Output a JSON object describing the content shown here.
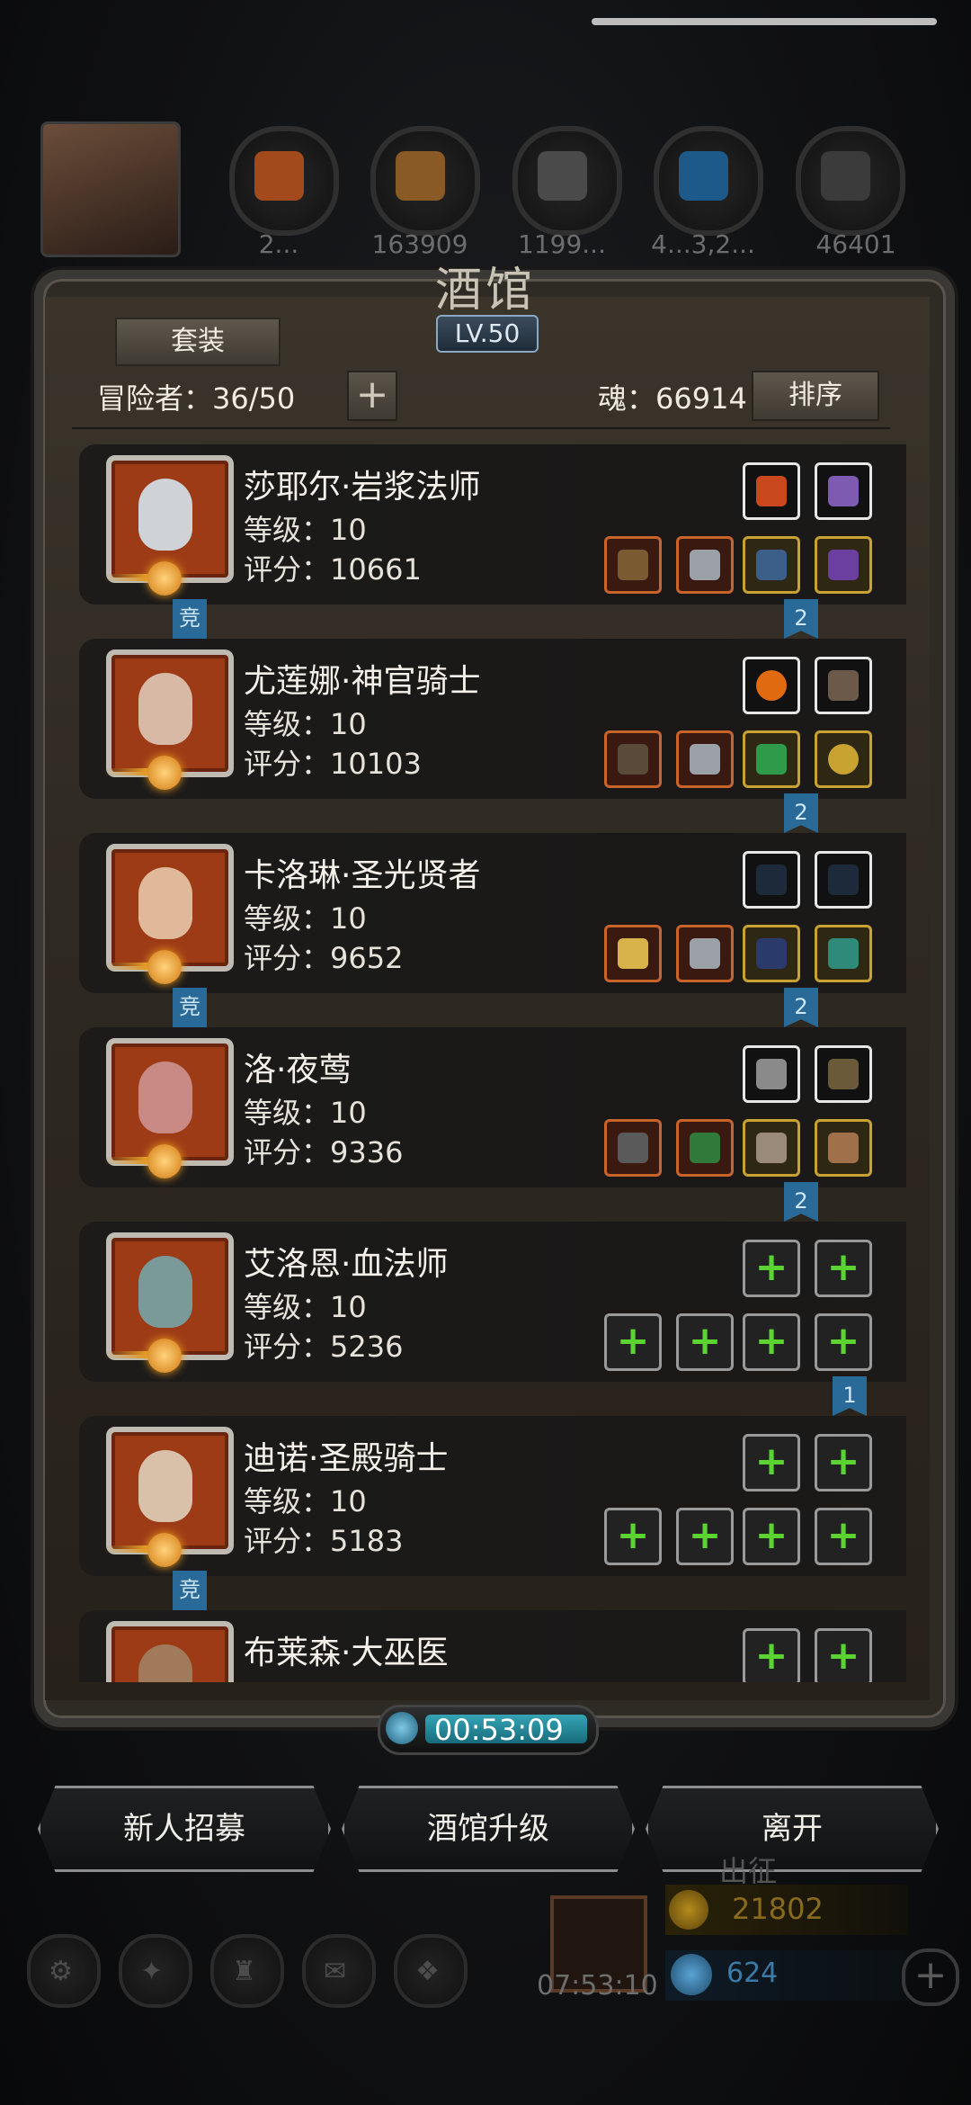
{
  "header": {
    "resources": [
      "2...",
      "163909",
      "1199...",
      "4...3,2...",
      "46401"
    ],
    "title": "酒馆",
    "level": "LV.50"
  },
  "toolbar": {
    "suit_label": "套装",
    "adventurers": "冒险者：36/50",
    "soul": "魂：66914",
    "sort_label": "排序"
  },
  "heroes": [
    {
      "name": "莎耶尔·岩浆法师",
      "level": "等级：10",
      "score": "评分：10661",
      "left_tag": "竞",
      "right_tag": "2"
    },
    {
      "name": "尤莲娜·神官骑士",
      "level": "等级：10",
      "score": "评分：10103",
      "left_tag": "",
      "right_tag": "2"
    },
    {
      "name": "卡洛琳·圣光贤者",
      "level": "等级：10",
      "score": "评分：9652",
      "left_tag": "竞",
      "right_tag": "2"
    },
    {
      "name": "洛·夜莺",
      "level": "等级：10",
      "score": "评分：9336",
      "left_tag": "",
      "right_tag": "2"
    },
    {
      "name": "艾洛恩·血法师",
      "level": "等级：10",
      "score": "评分：5236",
      "left_tag": "",
      "right_tag": "1"
    },
    {
      "name": "迪诺·圣殿骑士",
      "level": "等级：10",
      "score": "评分：5183",
      "left_tag": "竞",
      "right_tag": ""
    },
    {
      "name": "布莱森·大巫医",
      "level": "",
      "score": "",
      "left_tag": "",
      "right_tag": ""
    }
  ],
  "timer": "00:53:09",
  "actions": {
    "recruit": "新人招募",
    "upgrade": "酒馆升级",
    "leave": "离开"
  },
  "bottom": {
    "expedition": "出征",
    "gift_time": "07:53:10",
    "gold": "21802",
    "gems": "624"
  }
}
